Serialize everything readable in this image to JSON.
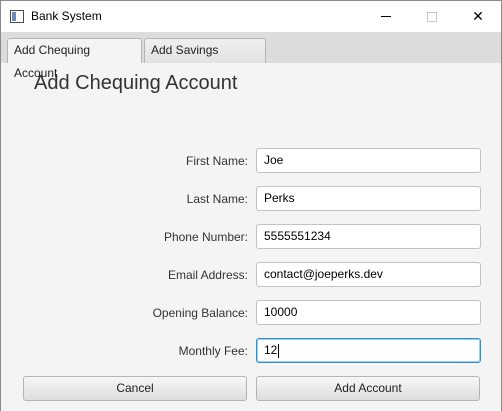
{
  "window": {
    "title": "Bank System",
    "controls": {
      "minimize": "minimize",
      "maximize": "maximize",
      "close": "close"
    }
  },
  "tabs": [
    {
      "label": "Add Chequing Account",
      "selected": true
    },
    {
      "label": "Add Savings Account",
      "selected": false
    }
  ],
  "form": {
    "heading": "Add Chequing Account",
    "fields": [
      {
        "label": "First Name:",
        "value": "Joe"
      },
      {
        "label": "Last Name:",
        "value": "Perks"
      },
      {
        "label": "Phone Number:",
        "value": "5555551234"
      },
      {
        "label": "Email Address:",
        "value": "contact@joeperks.dev"
      },
      {
        "label": "Opening Balance:",
        "value": "10000"
      },
      {
        "label": "Monthly Fee:",
        "value": "12"
      }
    ]
  },
  "buttons": {
    "cancel": "Cancel",
    "add": "Add Account"
  },
  "colors": {
    "focus_border": "#2f8fd0",
    "tabbar": "#dcdcdc",
    "background": "#f4f4f4"
  }
}
